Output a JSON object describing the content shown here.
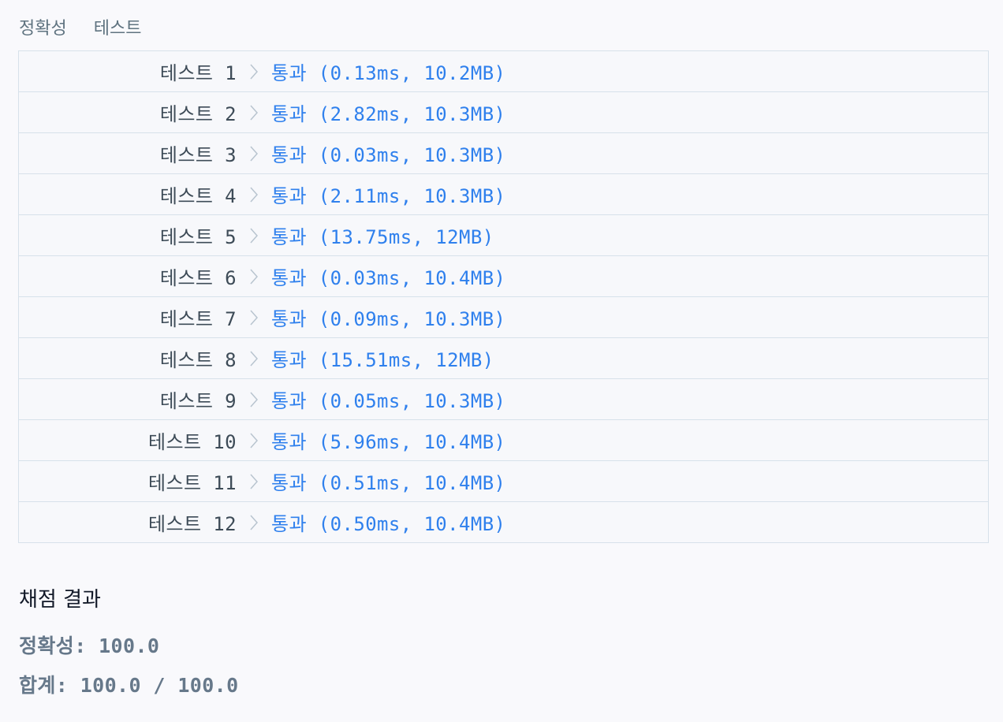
{
  "header": {
    "title": "정확성",
    "subtitle": "테스트"
  },
  "rows": [
    {
      "label": "테스트 1",
      "result": "통과 (0.13ms, 10.2MB)"
    },
    {
      "label": "테스트 2",
      "result": "통과 (2.82ms, 10.3MB)"
    },
    {
      "label": "테스트 3",
      "result": "통과 (0.03ms, 10.3MB)"
    },
    {
      "label": "테스트 4",
      "result": "통과 (2.11ms, 10.3MB)"
    },
    {
      "label": "테스트 5",
      "result": "통과 (13.75ms, 12MB)"
    },
    {
      "label": "테스트 6",
      "result": "통과 (0.03ms, 10.4MB)"
    },
    {
      "label": "테스트 7",
      "result": "통과 (0.09ms, 10.3MB)"
    },
    {
      "label": "테스트 8",
      "result": "통과 (15.51ms, 12MB)"
    },
    {
      "label": "테스트 9",
      "result": "통과 (0.05ms, 10.3MB)"
    },
    {
      "label": "테스트 10",
      "result": "통과 (5.96ms, 10.4MB)"
    },
    {
      "label": "테스트 11",
      "result": "통과 (0.51ms, 10.4MB)"
    },
    {
      "label": "테스트 12",
      "result": "통과 (0.50ms, 10.4MB)"
    }
  ],
  "score": {
    "title": "채점 결과",
    "accuracy": "정확성: 100.0",
    "total": "합계: 100.0 / 100.0"
  },
  "colors": {
    "pass": "#2f80ed",
    "label": "#3d4b57",
    "muted": "#66788a",
    "border": "#d7e1ea"
  },
  "icons": {
    "chevron": "chevron-right-icon"
  }
}
